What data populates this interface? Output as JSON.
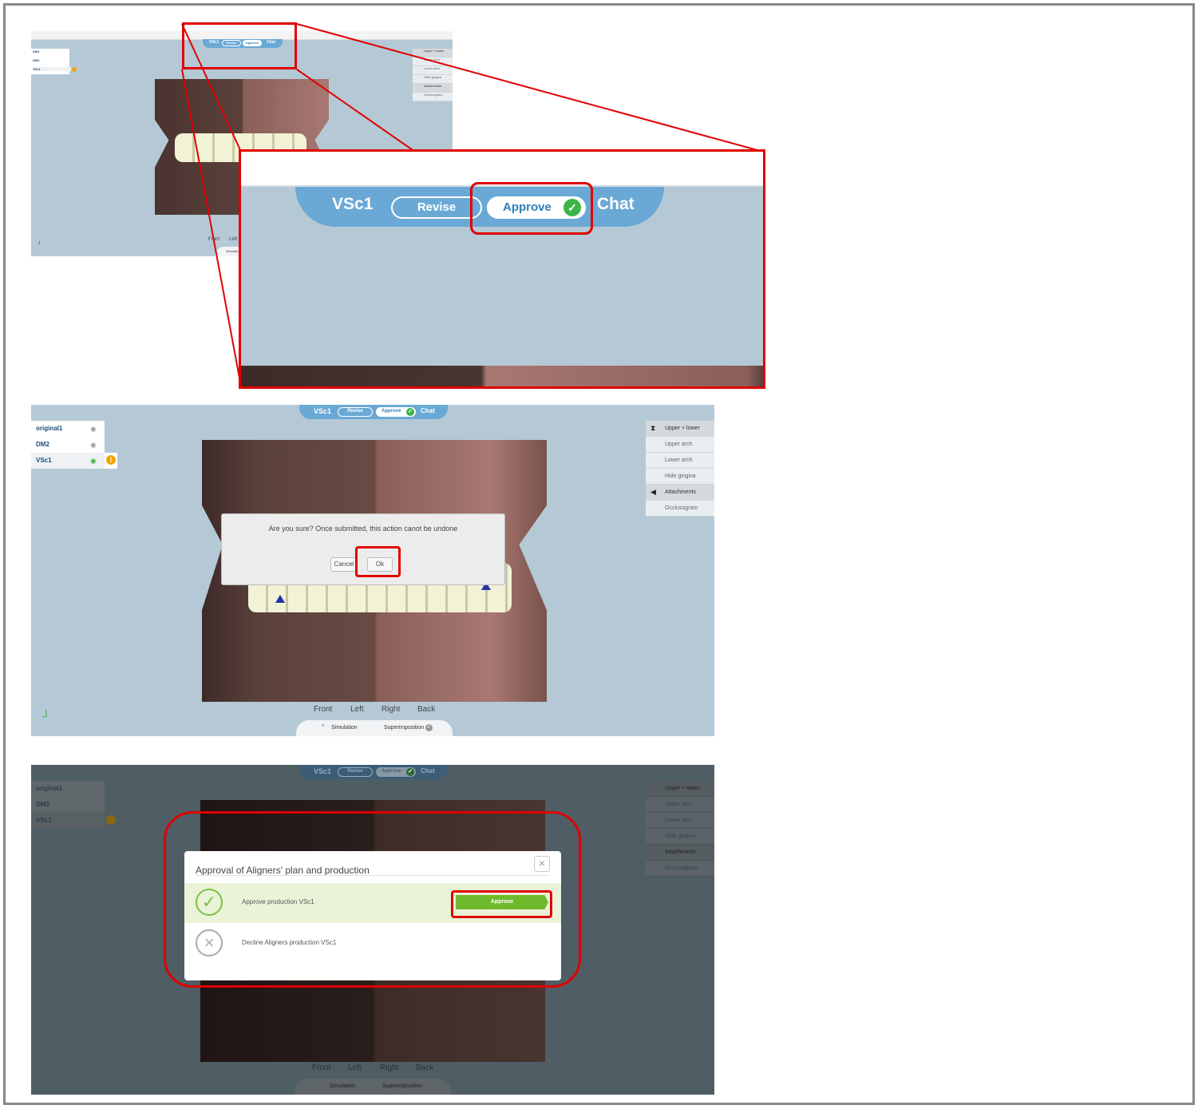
{
  "top_bar": {
    "label": "VSc1",
    "revise": "Revise",
    "approve": "Approve",
    "chat": "Chat"
  },
  "sidebar": {
    "items_small": [
      {
        "label": "DM1"
      },
      {
        "label": "DM2"
      },
      {
        "label": "VSc1"
      }
    ],
    "items": [
      {
        "label": "original1"
      },
      {
        "label": "DM2"
      },
      {
        "label": "VSc1"
      }
    ]
  },
  "right_panel": {
    "items": [
      {
        "label": "Upper + lower",
        "icon": "upper-lower-icon"
      },
      {
        "label": "Upper arch",
        "icon": "upper-arch-icon"
      },
      {
        "label": "Lower arch",
        "icon": "lower-arch-icon"
      },
      {
        "label": "Hide gingiva",
        "icon": "gingiva-icon"
      },
      {
        "label": "Attachments",
        "icon": "attachment-icon"
      },
      {
        "label": "Occlusogram",
        "icon": "occlusogram-icon"
      }
    ]
  },
  "views": {
    "front": "Front",
    "left": "Left",
    "right": "Right",
    "back": "Back"
  },
  "bottom_tabs": {
    "simulation": "Simulation",
    "superimposition": "Superimposition"
  },
  "confirm_dialog": {
    "message": "Are you sure? Once submitted, this action canot be undone",
    "cancel": "Cancel",
    "ok": "Ok"
  },
  "approval_modal": {
    "title": "Approval of Aligners' plan and production",
    "approve_text": "Approve production VSc1",
    "approve_button": "Approve",
    "decline_text": "Decline Aligners production VSc1"
  },
  "colors": {
    "accent_blue": "#6aa9d6",
    "approve_green": "#6fba2c",
    "highlight_red": "#e00000",
    "viewport_bg": "#b4c9d5"
  }
}
